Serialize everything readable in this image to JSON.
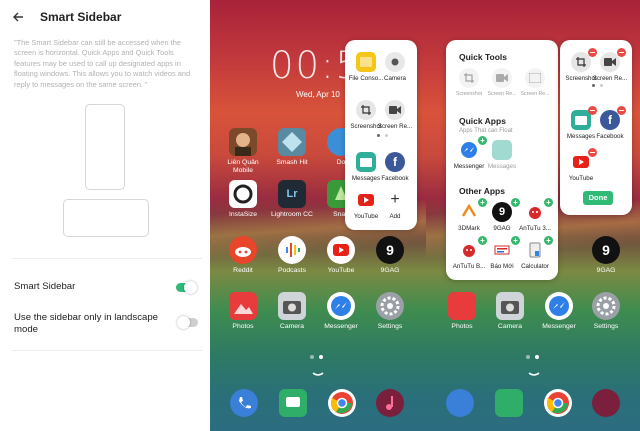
{
  "settings": {
    "title": "Smart Sidebar",
    "description": "\"The Smart Sidebar can still be accessed when the screen is horizontal. Quick Apps and Quick Tools features may be used to call up designated apps in floating windows. This allows you to watch videos and reply to messages on the same screen. \"",
    "options": [
      {
        "label": "Smart Sidebar",
        "enabled": true
      },
      {
        "label": "Use the sidebar only in landscape mode",
        "enabled": false
      }
    ]
  },
  "home": {
    "time": "00:5",
    "date": "Wed, Apr 10",
    "apps": [
      {
        "label": "Liên Quân Mobile",
        "color": "#7a4a2a",
        "icon": "game-icon"
      },
      {
        "label": "Smash Hit",
        "color": "#5a8aa0",
        "icon": "smash-hit-icon"
      },
      {
        "label": "Do",
        "color": "#3b8fd6",
        "icon": "app-icon"
      },
      {
        "label": "InstaSize",
        "color": "#ffffff",
        "icon": "instasize-icon"
      },
      {
        "label": "Lightroom CC",
        "color": "#1f2a35",
        "icon": "lightroom-icon",
        "glyph": "Lr"
      },
      {
        "label": "Snap",
        "color": "#3a9a3a",
        "icon": "snapseed-icon"
      },
      {
        "label": "Reddit",
        "color": "#e8452a",
        "icon": "reddit-icon"
      },
      {
        "label": "Podcasts",
        "color": "#ffffff",
        "icon": "podcasts-icon"
      },
      {
        "label": "YouTube",
        "color": "#ffffff",
        "icon": "youtube-icon"
      },
      {
        "label": "9GAG",
        "color": "#111111",
        "icon": "9gag-icon",
        "glyph": "9"
      },
      {
        "label": "Photos",
        "color": "#e83b3b",
        "icon": "photos-icon"
      },
      {
        "label": "Camera",
        "color": "#cfd4d8",
        "icon": "camera-icon"
      },
      {
        "label": "Messenger",
        "color": "#2f7fe8",
        "icon": "messenger-icon"
      },
      {
        "label": "Settings",
        "color": "#9aa0a6",
        "icon": "settings-gear-icon"
      }
    ],
    "dock": [
      {
        "icon": "phone-icon",
        "color": "#3a7fd8"
      },
      {
        "icon": "messages-icon",
        "color": "#2fae6a"
      },
      {
        "icon": "chrome-icon",
        "color": "#ffffff"
      },
      {
        "icon": "music-icon",
        "color": "#7a1f3c"
      }
    ]
  },
  "sidebar": {
    "items": [
      {
        "label": "File Conso...",
        "icon": "file-manager-icon",
        "color": "#f5c518"
      },
      {
        "label": "Camera",
        "icon": "camera-icon",
        "color": "#e8e8e8"
      },
      {
        "label": "Screenshot",
        "icon": "screenshot-icon",
        "color": "#e6e6e6"
      },
      {
        "label": "Screen Re...",
        "icon": "screen-record-icon",
        "color": "#e6e6e6"
      },
      {
        "label": "Messages",
        "icon": "messages-icon",
        "color": "#2fae9a"
      },
      {
        "label": "Facebook",
        "icon": "facebook-icon",
        "color": "#3b5998"
      },
      {
        "label": "YouTube",
        "icon": "youtube-icon",
        "color": "#ffffff"
      },
      {
        "label": "Add",
        "icon": "add-icon",
        "color": "#ffffff"
      }
    ]
  },
  "edit": {
    "quick_tools_title": "Quick Tools",
    "quick_tools": [
      "Screenshot",
      "Screen Re...",
      "Screen Re..."
    ],
    "quick_apps_title": "Quick Apps",
    "quick_apps_subtitle": "Apps That can Float",
    "quick_apps": [
      "Messenger",
      "Messages"
    ],
    "other_apps_title": "Other Apps",
    "other_apps": [
      "3DMark",
      "9GAG",
      "AnTuTu 3...",
      "AnTuTu B...",
      "Báo Mới",
      "Calculator"
    ],
    "side_items": [
      "Screenshot",
      "Screen Re...",
      "Messages",
      "Facebook",
      "YouTube"
    ],
    "done_label": "Done"
  }
}
